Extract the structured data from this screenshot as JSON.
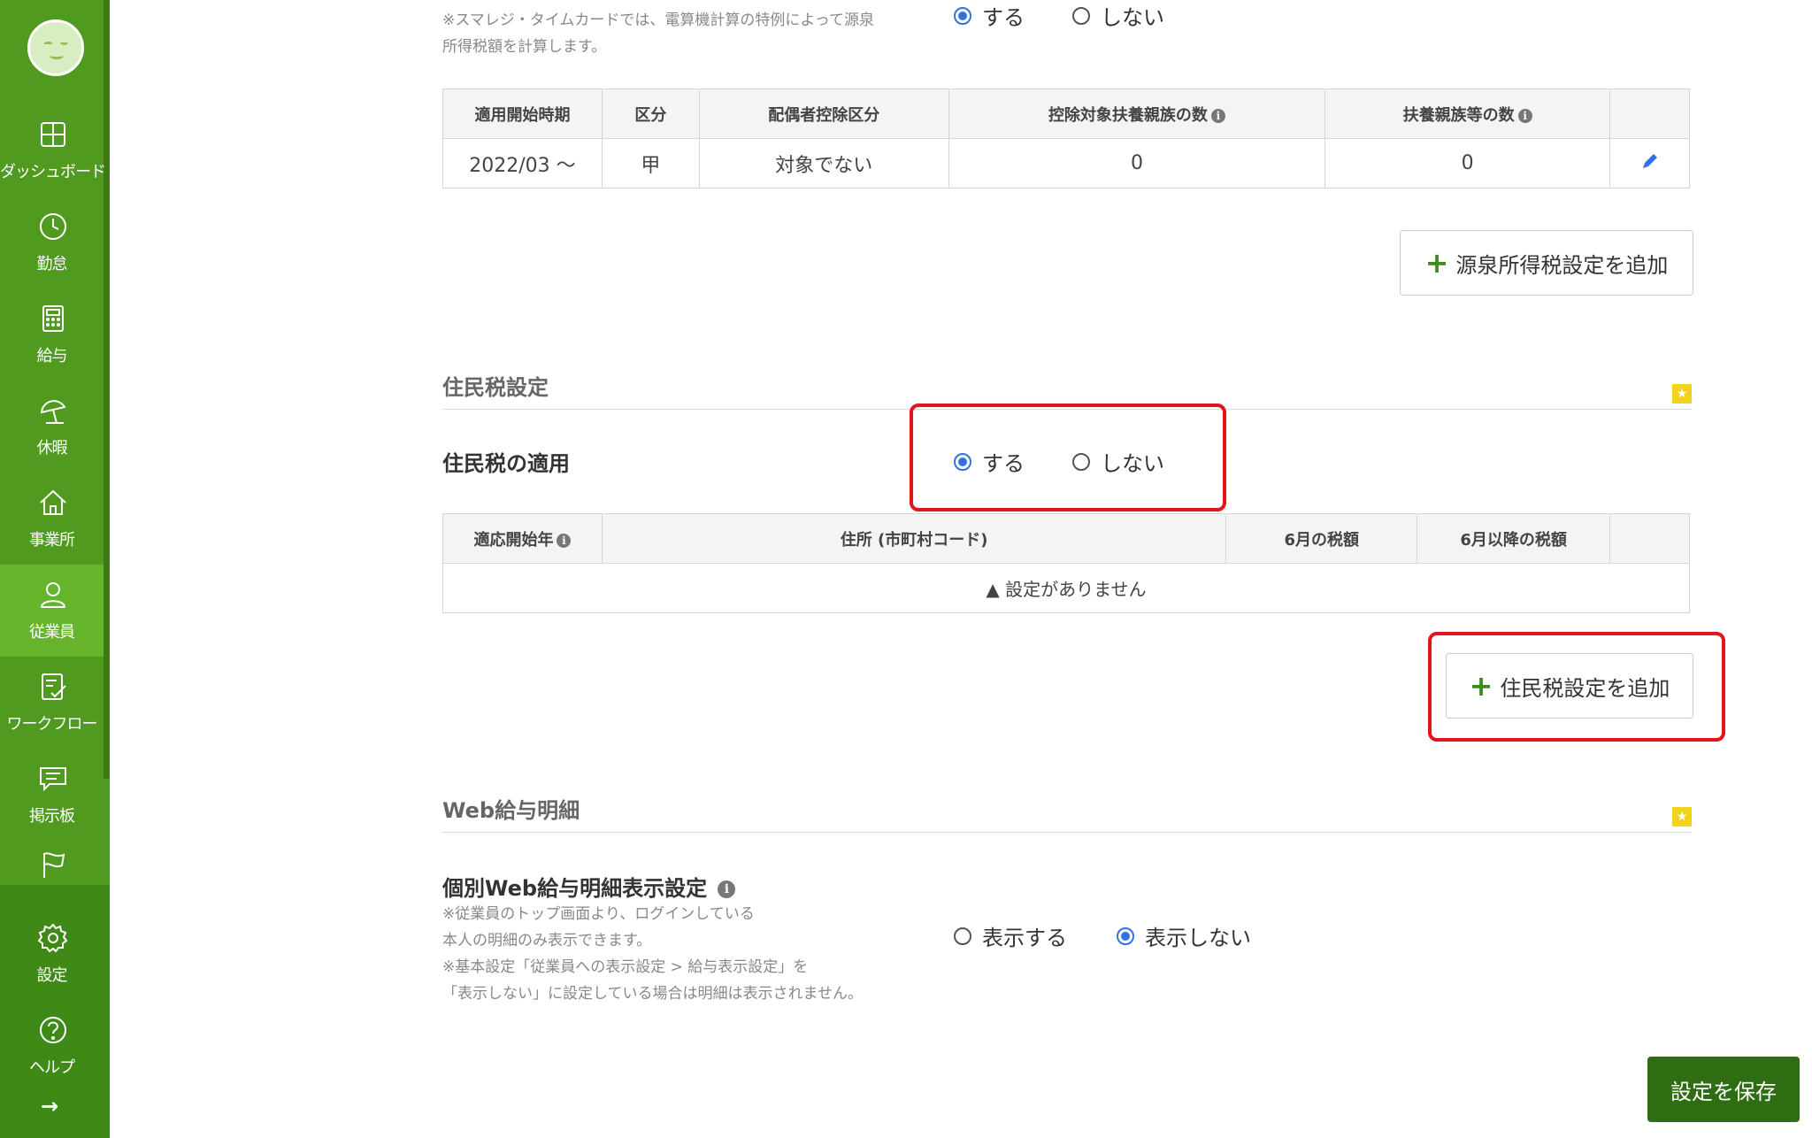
{
  "sidebar": {
    "items": [
      {
        "label": "ダッシュボード",
        "icon": "dashboard-icon"
      },
      {
        "label": "勤怠",
        "icon": "clock-icon"
      },
      {
        "label": "給与",
        "icon": "calculator-icon"
      },
      {
        "label": "休暇",
        "icon": "beach-umbrella-icon"
      },
      {
        "label": "事業所",
        "icon": "home-icon"
      },
      {
        "label": "従業員",
        "icon": "person-icon"
      },
      {
        "label": "ワークフロー",
        "icon": "checklist-icon"
      },
      {
        "label": "掲示板",
        "icon": "message-icon"
      },
      {
        "label": "",
        "icon": "flag-icon"
      },
      {
        "label": "設定",
        "icon": "gear-icon"
      },
      {
        "label": "ヘルプ",
        "icon": "help-icon"
      }
    ],
    "active": "従業員",
    "expand_arrow": "→"
  },
  "withholding": {
    "note_line1": "※スマレジ・タイムカードでは、電算機計算の特例によって源泉",
    "note_line2": "所得税額を計算します。",
    "radio_yes": "する",
    "radio_no": "しない",
    "table": {
      "headers": [
        "適用開始時期",
        "区分",
        "配偶者控除区分",
        "控除対象扶養親族の数",
        "扶養親族等の数",
        ""
      ],
      "rows": [
        [
          "2022/03 〜",
          "甲",
          "対象でない",
          "0",
          "0",
          ""
        ]
      ]
    },
    "add_button": "源泉所得税設定を追加"
  },
  "resident_tax": {
    "section_title": "住民税設定",
    "apply_label": "住民税の適用",
    "radio_yes": "する",
    "radio_no": "しない",
    "table": {
      "headers": [
        "適応開始年",
        "住所 (市町村コード)",
        "6月の税額",
        "6月以降の税額",
        ""
      ],
      "empty_message": "設定がありません"
    },
    "add_button": "住民税設定を追加"
  },
  "web_payslip": {
    "section_title": "Web給与明細",
    "field_label": "個別Web給与明細表示設定",
    "note_line1": "※従業員のトップ画面より、ログインしている",
    "note_line2": "本人の明細のみ表示できます。",
    "note_line3": "※基本設定「従業員への表示設定 > 給与表示設定」を",
    "note_line4": "「表示しない」に設定している場合は明細は表示されません。",
    "radio_show": "表示する",
    "radio_hide": "表示しない"
  },
  "save_button": "設定を保存",
  "colors": {
    "sidebar": "#4f9a1f",
    "sidebar_active": "#66b32c",
    "save_button": "#2e6d12",
    "highlight": "#e5141b",
    "radio_selected": "#2f72e0"
  }
}
